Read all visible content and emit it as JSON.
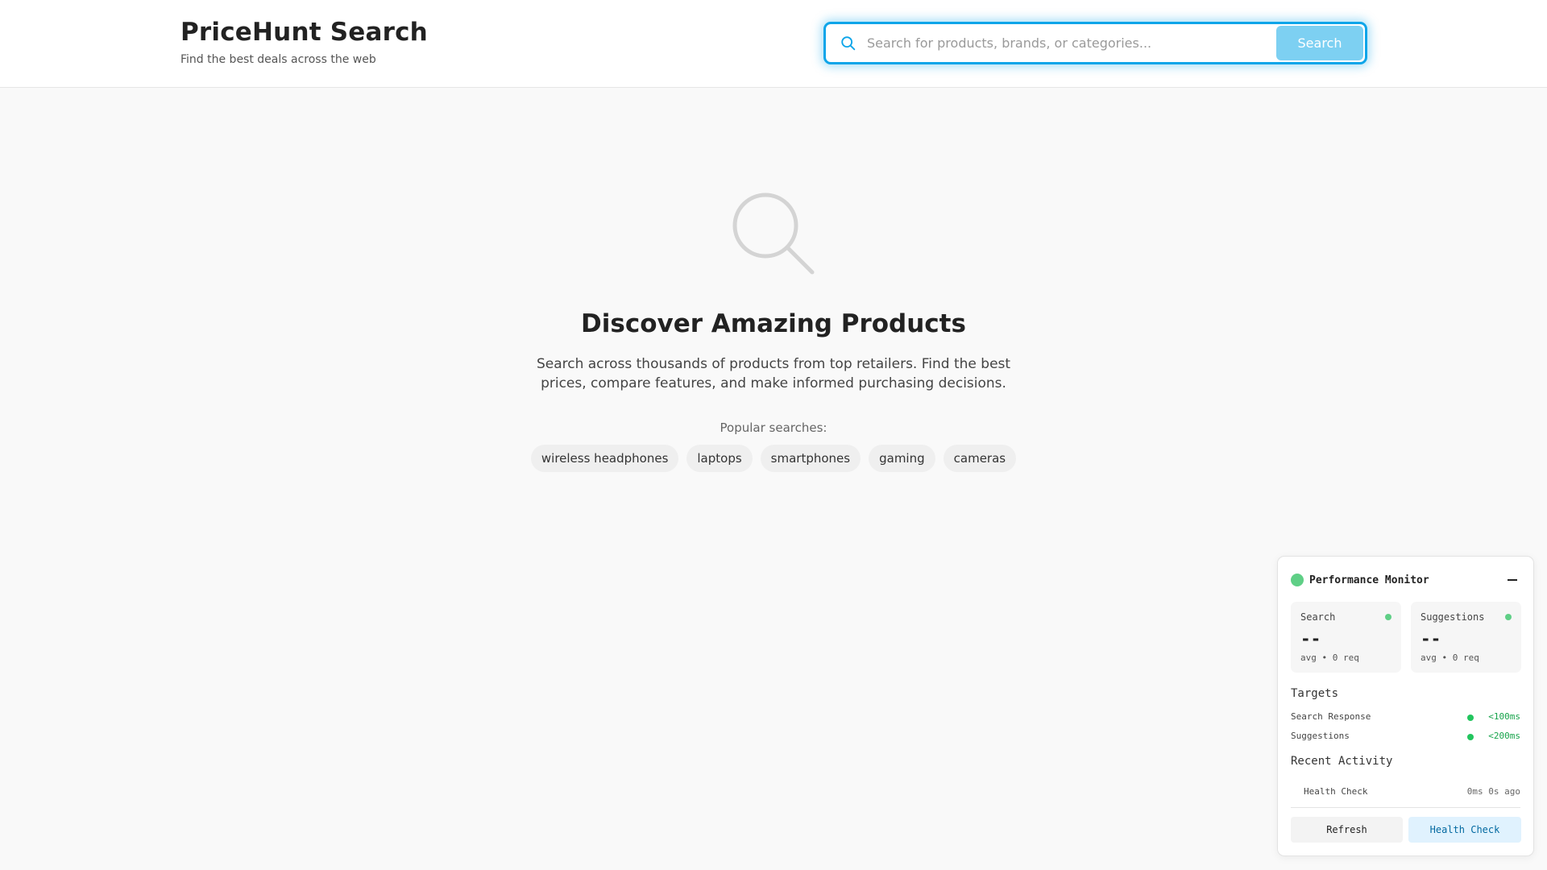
{
  "header": {
    "title": "PriceHunt Search",
    "tagline": "Find the best deals across the web",
    "search_placeholder": "Search for products, brands, or categories...",
    "search_button": "Search"
  },
  "hero": {
    "icon": "magnifier-icon",
    "title": "Discover Amazing Products",
    "description": "Search across thousands of products from top retailers. Find the best prices, compare features, and make informed purchasing decisions.",
    "popular_label": "Popular searches:",
    "popular": [
      "wireless headphones",
      "laptops",
      "smartphones",
      "gaming",
      "cameras"
    ]
  },
  "perf_monitor": {
    "title": "Performance Monitor",
    "status_color": "#5fcf86",
    "metrics": [
      {
        "label": "Search",
        "value": "--",
        "sub": "avg • 0 req"
      },
      {
        "label": "Suggestions",
        "value": "--",
        "sub": "avg • 0 req"
      }
    ],
    "targets_title": "Targets",
    "targets": [
      {
        "label": "Search Response",
        "value": "<100ms"
      },
      {
        "label": "Suggestions",
        "value": "<200ms"
      }
    ],
    "activity_title": "Recent Activity",
    "activity": [
      {
        "label": "Health Check",
        "time": "0ms 0s ago"
      }
    ],
    "refresh_button": "Refresh",
    "health_button": "Health Check"
  },
  "colors": {
    "accent": "#0ea5e9",
    "success": "#22c55e"
  }
}
